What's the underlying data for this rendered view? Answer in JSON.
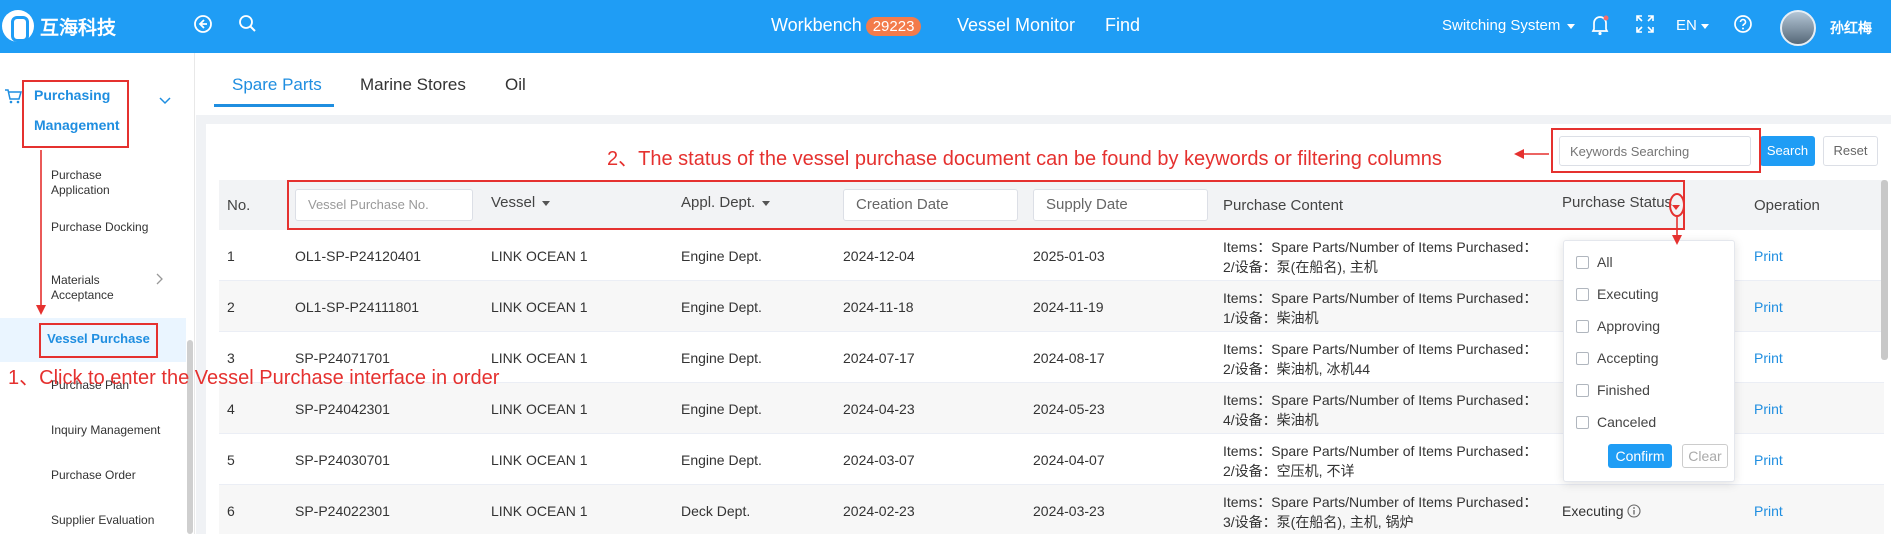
{
  "header": {
    "brand": "互海科技",
    "nav": {
      "workbench": "Workbench",
      "workbench_count": "29223",
      "vessel_monitor": "Vessel Monitor",
      "find": "Find"
    },
    "switching_system": "Switching System",
    "language": "EN",
    "user_name": "孙红梅",
    "icons": [
      "logo-icon",
      "back-icon",
      "search-icon",
      "bell-icon",
      "fullscreen-icon",
      "help-icon"
    ]
  },
  "sidebar": {
    "group_line1": "Purchasing",
    "group_line2": "Management",
    "items": [
      {
        "line1": "Purchase",
        "line2": "Application"
      },
      {
        "line1": "Purchase Docking",
        "line2": ""
      },
      {
        "line1": "Materials",
        "line2": "Acceptance"
      },
      {
        "line1": "Vessel Purchase",
        "line2": ""
      },
      {
        "line1": "Purchase Plan",
        "line2": ""
      },
      {
        "line1": "Inquiry Management",
        "line2": ""
      },
      {
        "line1": "Purchase Order",
        "line2": ""
      },
      {
        "line1": "Supplier Evaluation",
        "line2": ""
      }
    ]
  },
  "tabs": [
    "Spare Parts",
    "Marine Stores",
    "Oil"
  ],
  "annotations": {
    "step1": "1、Click to enter the Vessel Purchase interface in order",
    "step2": "2、The status of the vessel purchase document can be found by keywords or filtering columns"
  },
  "search": {
    "placeholder": "Keywords Searching",
    "search_label": "Search",
    "reset_label": "Reset"
  },
  "table": {
    "headers": {
      "no": "No.",
      "vessel_purchase_no": "Vessel Purchase No.",
      "vessel": "Vessel",
      "appl_dept": "Appl. Dept.",
      "creation_date": "Creation Date",
      "supply_date": "Supply Date",
      "purchase_content": "Purchase Content",
      "purchase_status": "Purchase Status",
      "operation": "Operation"
    },
    "rows": [
      {
        "no": "1",
        "purchase_no": "OL1-SP-P24120401",
        "vessel": "LINK OCEAN 1",
        "dept": "Engine Dept.",
        "created": "2024-12-04",
        "supply": "2025-01-03",
        "content1": "Items：Spare Parts/Number of Items Purchased：",
        "content2": "2/设备：泵(在船名), 主机",
        "status": "",
        "op": "Print"
      },
      {
        "no": "2",
        "purchase_no": "OL1-SP-P24111801",
        "vessel": "LINK OCEAN 1",
        "dept": "Engine Dept.",
        "created": "2024-11-18",
        "supply": "2024-11-19",
        "content1": "Items：Spare Parts/Number of Items Purchased：",
        "content2": "1/设备：柴油机",
        "status": "",
        "op": "Print"
      },
      {
        "no": "3",
        "purchase_no": "SP-P24071701",
        "vessel": "LINK OCEAN 1",
        "dept": "Engine Dept.",
        "created": "2024-07-17",
        "supply": "2024-08-17",
        "content1": "Items：Spare Parts/Number of Items Purchased：",
        "content2": "2/设备：柴油机, 冰机44",
        "status": "",
        "op": "Print"
      },
      {
        "no": "4",
        "purchase_no": "SP-P24042301",
        "vessel": "LINK OCEAN 1",
        "dept": "Engine Dept.",
        "created": "2024-04-23",
        "supply": "2024-05-23",
        "content1": "Items：Spare Parts/Number of Items Purchased：",
        "content2": "4/设备：柴油机",
        "status": "",
        "op": "Print"
      },
      {
        "no": "5",
        "purchase_no": "SP-P24030701",
        "vessel": "LINK OCEAN 1",
        "dept": "Engine Dept.",
        "created": "2024-03-07",
        "supply": "2024-04-07",
        "content1": "Items：Spare Parts/Number of Items Purchased：",
        "content2": "2/设备：空压机, 不详",
        "status": "",
        "op": "Print"
      },
      {
        "no": "6",
        "purchase_no": "SP-P24022301",
        "vessel": "LINK OCEAN 1",
        "dept": "Deck Dept.",
        "created": "2024-02-23",
        "supply": "2024-03-23",
        "content1": "Items：Spare Parts/Number of Items Purchased：",
        "content2": "3/设备：泵(在船名), 主机, 锅炉",
        "status": "Executing",
        "op": "Print"
      }
    ]
  },
  "status_filter": {
    "options": [
      "All",
      "Executing",
      "Approving",
      "Accepting",
      "Finished",
      "Canceled"
    ],
    "confirm_label": "Confirm",
    "clear_label": "Clear"
  },
  "colors": {
    "primary": "#1f9df5",
    "annotation": "#e5312f",
    "badge": "#f37b4b"
  }
}
